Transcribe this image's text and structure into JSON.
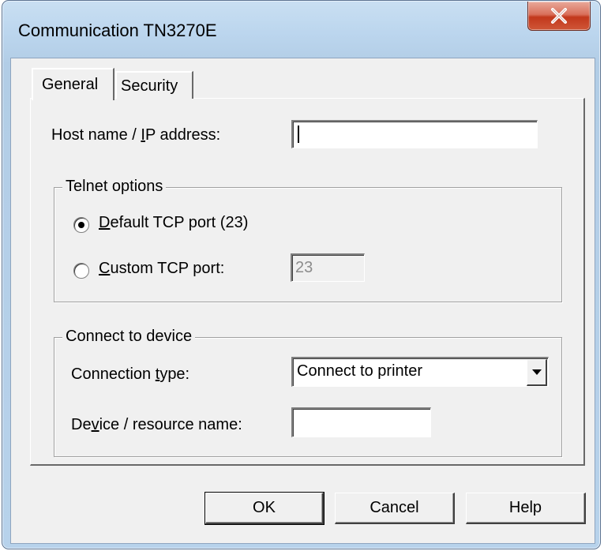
{
  "window": {
    "title": "Communication TN3270E",
    "close_label": "X"
  },
  "tabs": [
    {
      "label": "General",
      "selected": true
    },
    {
      "label": "Security",
      "selected": false
    }
  ],
  "host": {
    "label_pre": "Host name / ",
    "label_mnemonic": "I",
    "label_post": "P address:",
    "value": ""
  },
  "telnet": {
    "group_label": "Telnet options",
    "default_pre": "",
    "default_mnemonic": "D",
    "default_post": "efault TCP port (23)",
    "custom_pre": "",
    "custom_mnemonic": "C",
    "custom_post": "ustom TCP port:",
    "custom_port_value": "23",
    "selected": "default"
  },
  "device": {
    "group_label": "Connect to device",
    "conn_label_pre": "Connection ",
    "conn_label_mnemonic": "t",
    "conn_label_post": "ype:",
    "connection_type_value": "Connect to printer",
    "resource_label_pre": "De",
    "resource_label_mnemonic": "v",
    "resource_label_post": "ice / resource name:",
    "resource_value": ""
  },
  "buttons": {
    "ok": "OK",
    "cancel": "Cancel",
    "help": "Help"
  }
}
